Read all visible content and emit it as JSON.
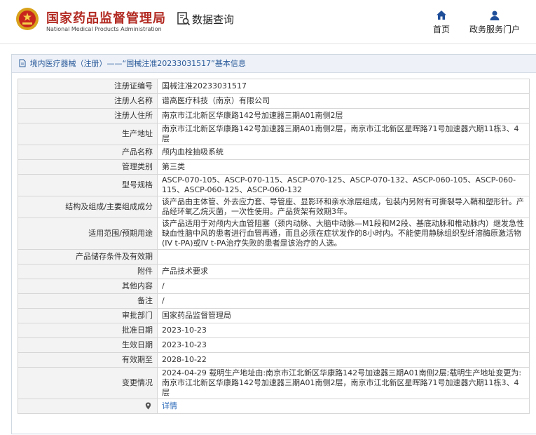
{
  "header": {
    "site_title": "国家药品监督管理局",
    "site_subtitle": "National Medical Products Administration",
    "query_label": "数据查询",
    "nav": [
      {
        "label": "首页",
        "icon": "home-icon"
      },
      {
        "label": "政务服务门户",
        "icon": "user-icon"
      }
    ],
    "brand_color": "#b22a22"
  },
  "panel": {
    "title": "境内医疗器械（注册）——“国械注准20233031517”基本信息",
    "rows": [
      {
        "label": "注册证编号",
        "value": "国械注准20233031517"
      },
      {
        "label": "注册人名称",
        "value": "谱高医疗科技（南京）有限公司"
      },
      {
        "label": "注册人住所",
        "value": "南京市江北新区华康路142号加速器三期A01南侧2层"
      },
      {
        "label": "生产地址",
        "value": "南京市江北新区华康路142号加速器三期A01南侧2层，南京市江北新区星晖路71号加速器六期11栋3、4层"
      },
      {
        "label": "产品名称",
        "value": "颅内血栓抽吸系统"
      },
      {
        "label": "管理类别",
        "value": "第三类"
      },
      {
        "label": "型号规格",
        "value": "ASCP-070-105、ASCP-070-115、ASCP-070-125、ASCP-070-132、ASCP-060-105、ASCP-060-115、ASCP-060-125、ASCP-060-132"
      },
      {
        "label": "结构及组成/主要组成成分",
        "value": "该产品由主体管、外去应力套、导管座、显影环和亲水涂层组成，包装内另附有可撕裂导入鞘和塑形针。产品经环氧乙烷灭菌，一次性使用。产品货架有效期3年。"
      },
      {
        "label": "适用范围/预期用途",
        "value": "该产品适用于对颅内大血管阻塞（颈内动脉、大脑中动脉—M1段和M2段、基底动脉和椎动脉内）继发急性缺血性脑中风的患者进行血管再通，而且必须在症状发作的8小时内。不能使用静脉组织型纤溶酶原激活物(IV t-PA)或IV t-PA治疗失败的患者是该治疗的人选。"
      },
      {
        "label": "产品储存条件及有效期",
        "value": ""
      },
      {
        "label": "附件",
        "value": "产品技术要求"
      },
      {
        "label": "其他内容",
        "value": "/"
      },
      {
        "label": "备注",
        "value": "/"
      },
      {
        "label": "审批部门",
        "value": "国家药品监督管理局"
      },
      {
        "label": "批准日期",
        "value": "2023-10-23"
      },
      {
        "label": "生效日期",
        "value": "2023-10-23"
      },
      {
        "label": "有效期至",
        "value": "2028-10-22"
      },
      {
        "label": "变更情况",
        "value": "2024-04-29 载明生产地址由:南京市江北新区华康路142号加速器三期A01南侧2层;载明生产地址变更为:南京市江北新区华康路142号加速器三期A01南侧2层，南京市江北新区星晖路71号加速器六期11栋3、4层"
      }
    ],
    "detail_link": "详情"
  }
}
